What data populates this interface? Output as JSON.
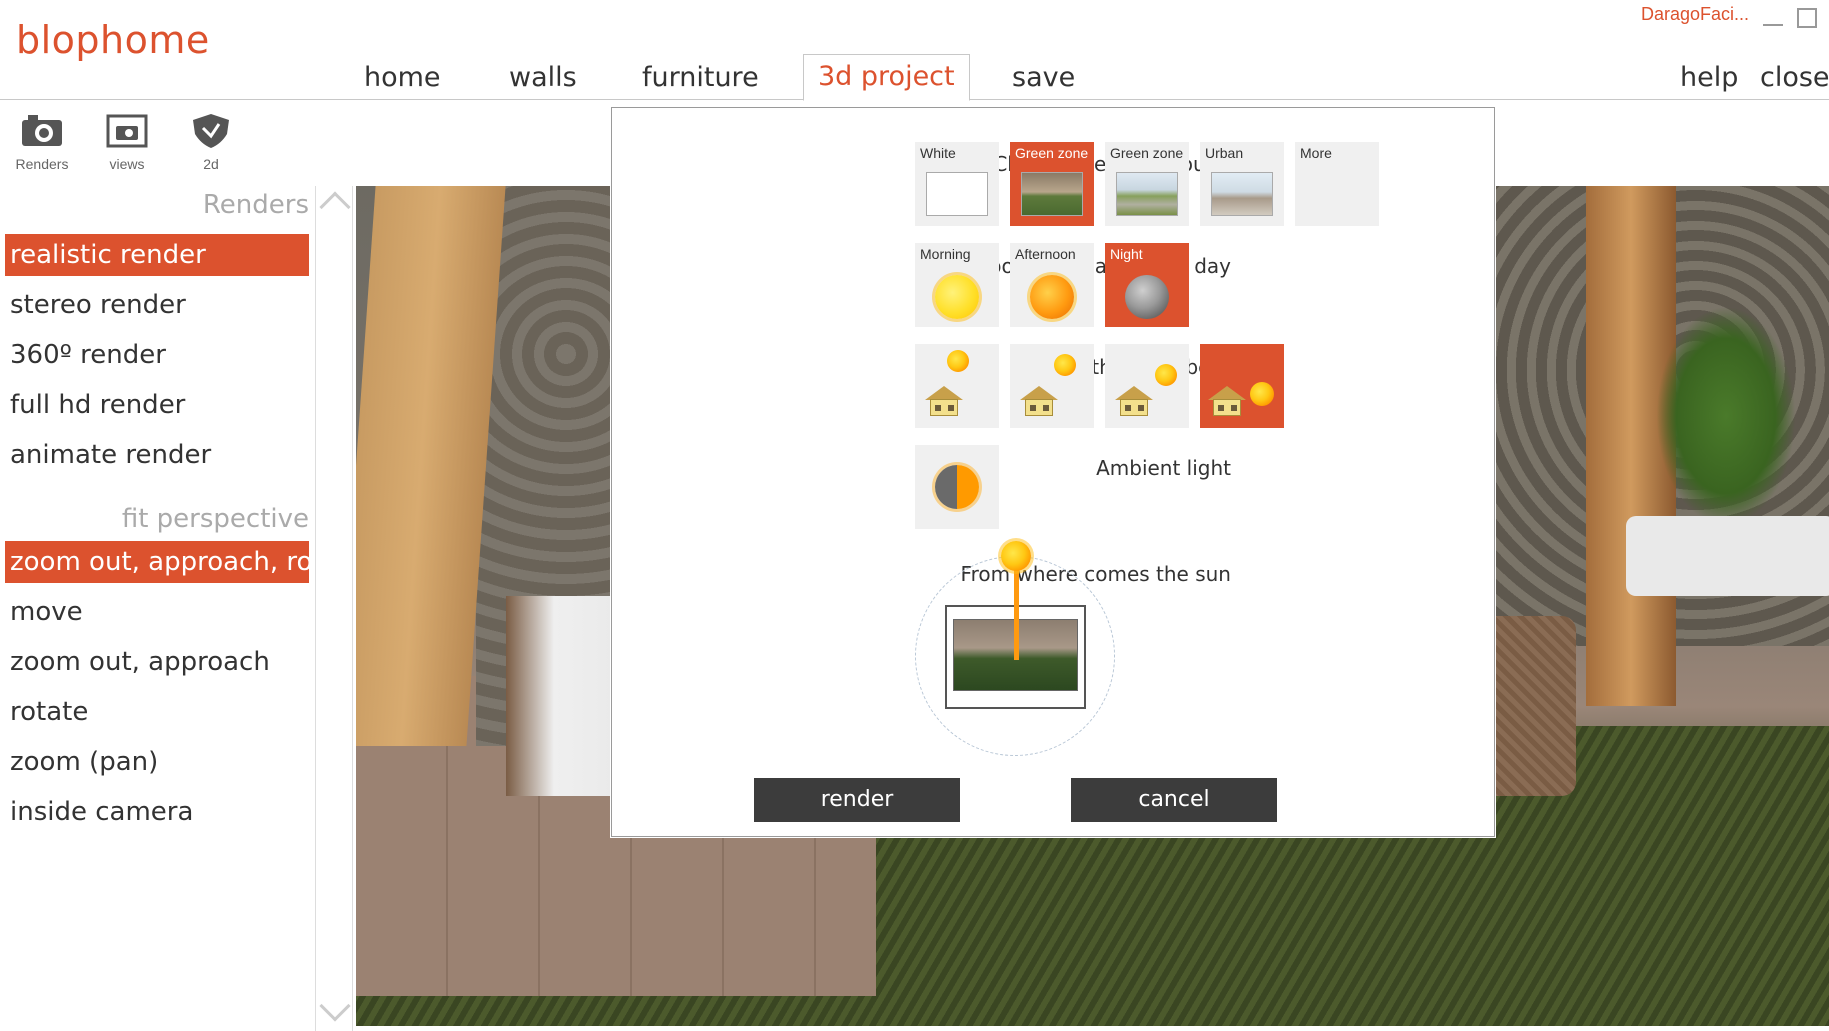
{
  "app": {
    "title": "blophome",
    "user": "DaragoFaci..."
  },
  "nav": {
    "home": "home",
    "walls": "walls",
    "furniture": "furniture",
    "project": "3d project",
    "save": "save",
    "help": "help",
    "close": "close"
  },
  "toolbar": {
    "renders": "Renders",
    "views": "views",
    "d2": "2d"
  },
  "left": {
    "renders_title": "Renders",
    "renders_items": [
      "realistic render",
      "stereo render",
      "360º render",
      "full hd render",
      "animate render"
    ],
    "perspective_title": "fit perspective",
    "perspective_items": [
      "zoom out, approach, rotate",
      "move",
      "zoom out, approach",
      "rotate",
      "zoom (pan)",
      "inside camera"
    ]
  },
  "dialog": {
    "background_label": "Choose the background",
    "background_options": [
      "White",
      "Green zone",
      "Green zone",
      "Urban",
      "More"
    ],
    "day_label": "Choose the part of the day",
    "day_options": [
      "Morning",
      "Afternoon",
      "Night"
    ],
    "solar_label": "Choose the solar bent",
    "ambient_label": "Ambient light",
    "sun_label": "From where comes the sun",
    "render_button": "render",
    "cancel_button": "cancel"
  },
  "colors": {
    "accent": "#dc522e",
    "button": "#3c3c3c"
  }
}
